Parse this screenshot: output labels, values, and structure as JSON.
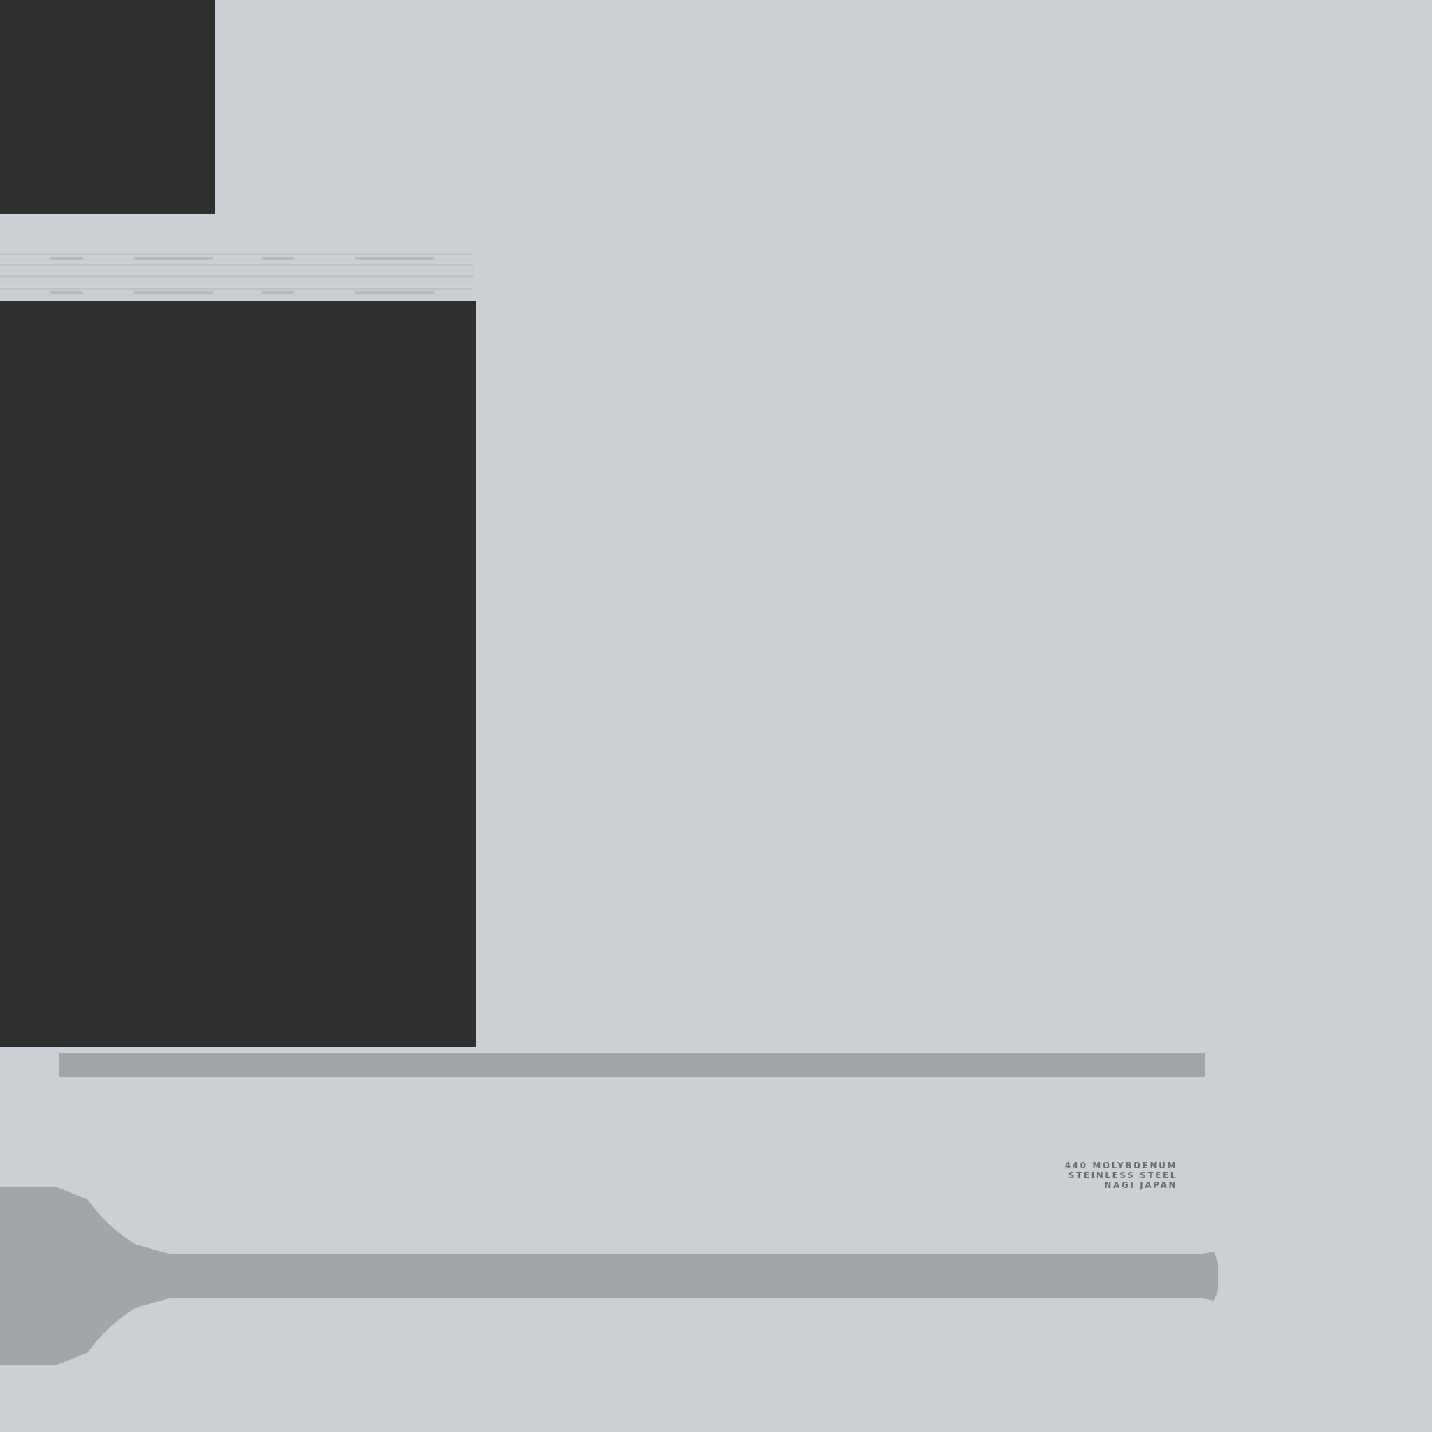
{
  "texture": {
    "background_color": "#ccd0d4",
    "dark_panel_color": "#2f2f2f",
    "bar_color": "#a2a6a9",
    "engraving_color": "#6a6e72"
  },
  "engraving": {
    "line1": "440 MOLYBDENUM",
    "line2": "STEINLESS STEEL",
    "line3": "NAGI JAPAN"
  }
}
